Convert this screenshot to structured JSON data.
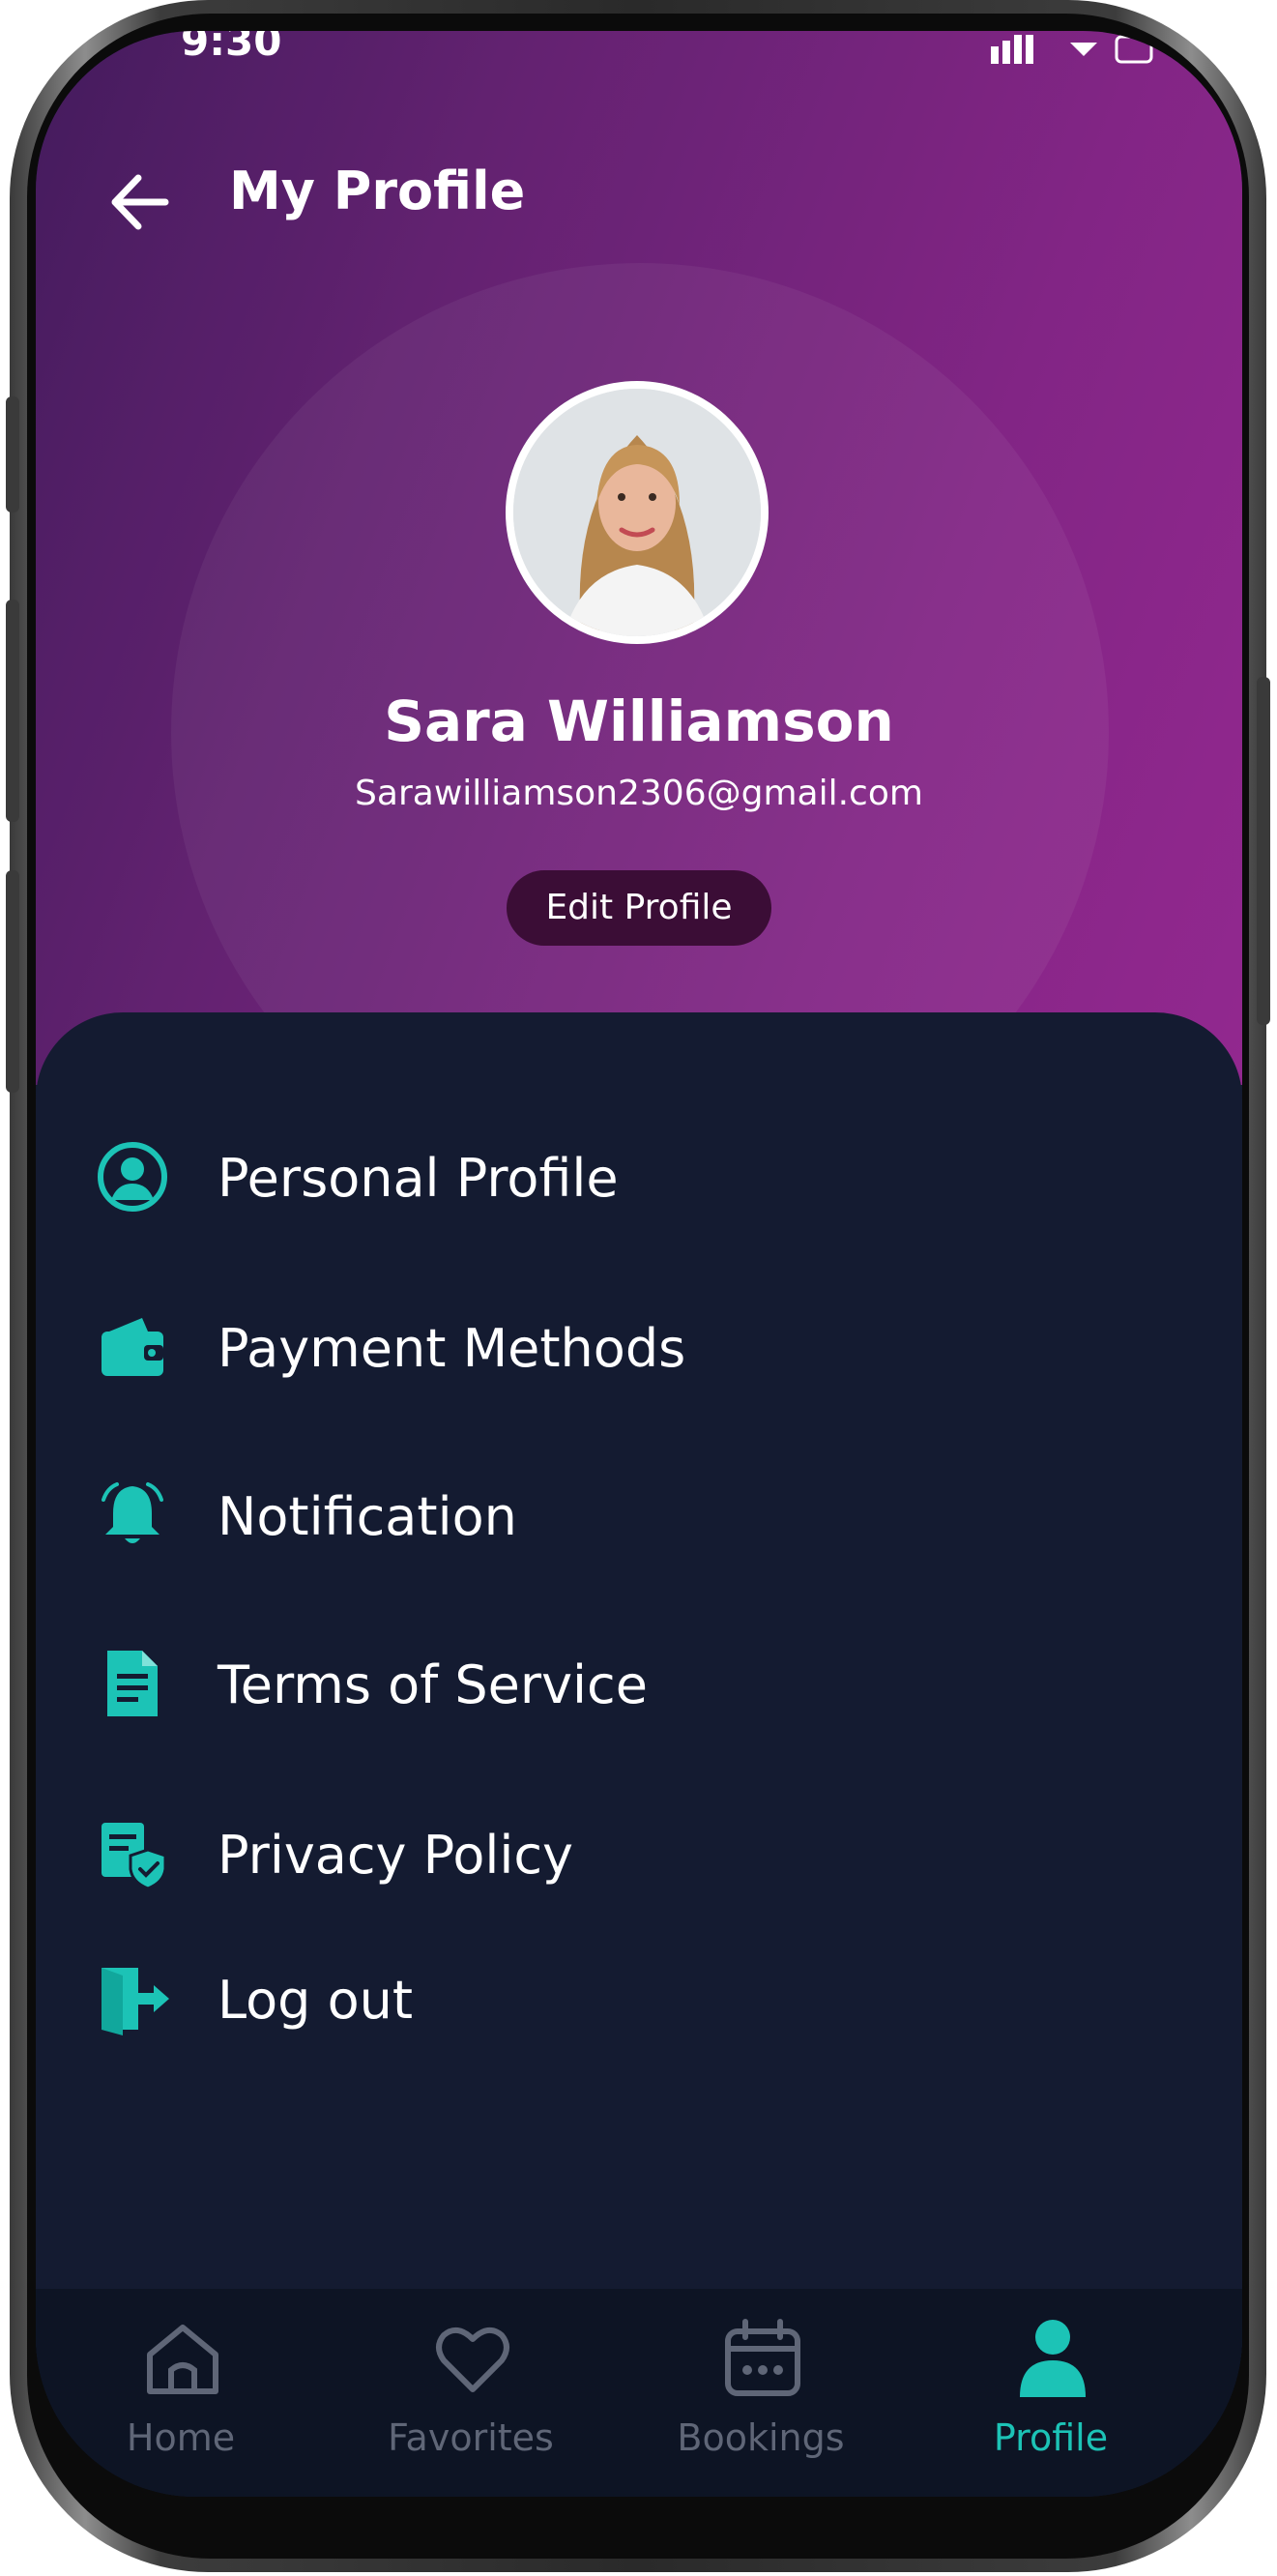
{
  "status": {
    "time": "9:30"
  },
  "header": {
    "title": "My Profile"
  },
  "profile": {
    "name": "Sara Williamson",
    "email": "Sarawilliamson2306@gmail.com",
    "edit_label": "Edit Profile",
    "avatar": "user-photo"
  },
  "menu": {
    "items": [
      {
        "label": "Personal Profile",
        "icon": "user-circle-icon"
      },
      {
        "label": "Payment Methods",
        "icon": "wallet-icon"
      },
      {
        "label": "Notification",
        "icon": "bell-icon"
      },
      {
        "label": "Terms of Service",
        "icon": "document-icon"
      },
      {
        "label": "Privacy Policy",
        "icon": "shield-document-icon"
      },
      {
        "label": "Log out",
        "icon": "logout-icon"
      }
    ]
  },
  "nav": {
    "tabs": [
      {
        "label": "Home",
        "icon": "home-icon",
        "active": false
      },
      {
        "label": "Favorites",
        "icon": "heart-icon",
        "active": false
      },
      {
        "label": "Bookings",
        "icon": "calendar-icon",
        "active": false
      },
      {
        "label": "Profile",
        "icon": "person-icon",
        "active": true
      }
    ]
  },
  "colors": {
    "accent": "#1cc3b6",
    "menu_bg": "#141b31",
    "header_start": "#3b0f55",
    "header_end": "#8d1d89"
  }
}
